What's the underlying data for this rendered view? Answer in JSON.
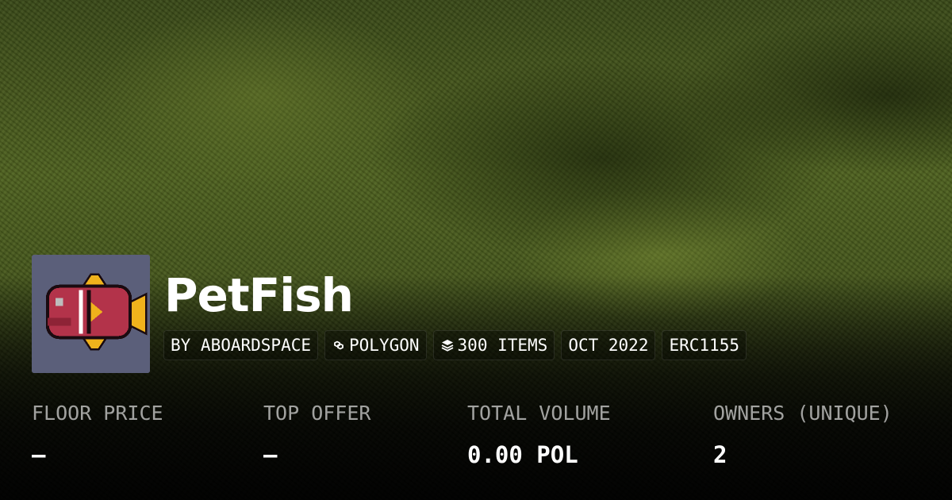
{
  "collection": {
    "name": "PetFish",
    "avatar_icon": "pixel-fish-icon",
    "avatar_bg": "#5b5f7a"
  },
  "tags": [
    {
      "label": "BY ABOARDSPACE",
      "icon": null
    },
    {
      "label": "POLYGON",
      "icon": "polygon-chain-icon"
    },
    {
      "label": "300 ITEMS",
      "icon": "stack-layers-icon"
    },
    {
      "label": "OCT 2022",
      "icon": null
    },
    {
      "label": "ERC1155",
      "icon": null
    }
  ],
  "stats": [
    {
      "label": "FLOOR PRICE",
      "value": "–"
    },
    {
      "label": "TOP OFFER",
      "value": "–"
    },
    {
      "label": "TOTAL VOLUME",
      "value": "0.00 POL"
    },
    {
      "label": "OWNERS (UNIQUE)",
      "value": "2"
    }
  ],
  "colors": {
    "fish_body": "#b3334a",
    "fish_fin": "#f0b21c",
    "outline": "#1a0b10"
  }
}
